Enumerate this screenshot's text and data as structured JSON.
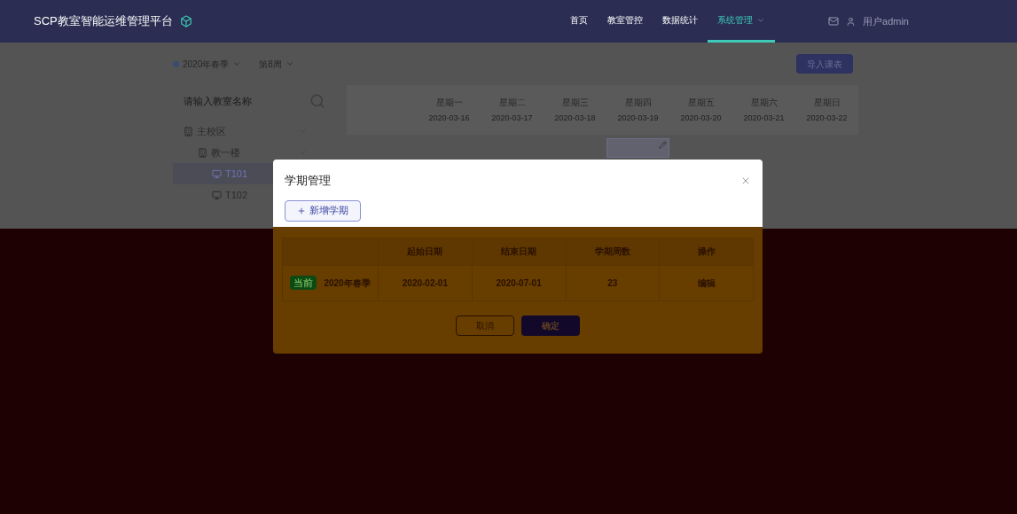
{
  "header": {
    "title": "SCP教室智能运维管理平台",
    "nav": [
      {
        "label": "首页",
        "selected": false
      },
      {
        "label": "教室管控",
        "selected": false
      },
      {
        "label": "数据统计",
        "selected": false
      },
      {
        "label": "系统管理",
        "selected": true,
        "dropdown": true
      }
    ],
    "user": "用户admin"
  },
  "toolbar": {
    "term": "2020年春季",
    "week": "第8周",
    "import_button": "导入课表"
  },
  "sidebar": {
    "search_placeholder": "请输入教室名称",
    "tree": [
      {
        "label": "主校区",
        "kind": "building",
        "selected": false,
        "children": [
          {
            "label": "教一楼",
            "kind": "building",
            "selected": false,
            "children": [
              {
                "label": "T101",
                "kind": "room",
                "selected": true
              },
              {
                "label": "T102",
                "kind": "room",
                "selected": false
              }
            ]
          }
        ]
      }
    ]
  },
  "week_header": [
    {
      "day": "星期一",
      "date": "2020-03-16"
    },
    {
      "day": "星期二",
      "date": "2020-03-17"
    },
    {
      "day": "星期三",
      "date": "2020-03-18"
    },
    {
      "day": "星期四",
      "date": "2020-03-19"
    },
    {
      "day": "星期五",
      "date": "2020-03-20"
    },
    {
      "day": "星期六",
      "date": "2020-03-21"
    },
    {
      "day": "星期日",
      "date": "2020-03-22"
    }
  ],
  "dialog": {
    "title": "学期管理",
    "add_button": "新增学期",
    "columns": [
      "起始日期",
      "结束日期",
      "学期周数",
      "操作"
    ],
    "rows": [
      {
        "tag": "当前",
        "name": "2020年春季",
        "start": "2020-02-01",
        "end": "2020-07-01",
        "weeks": "23",
        "action": "编辑"
      }
    ],
    "cancel": "取消",
    "confirm": "确定"
  }
}
